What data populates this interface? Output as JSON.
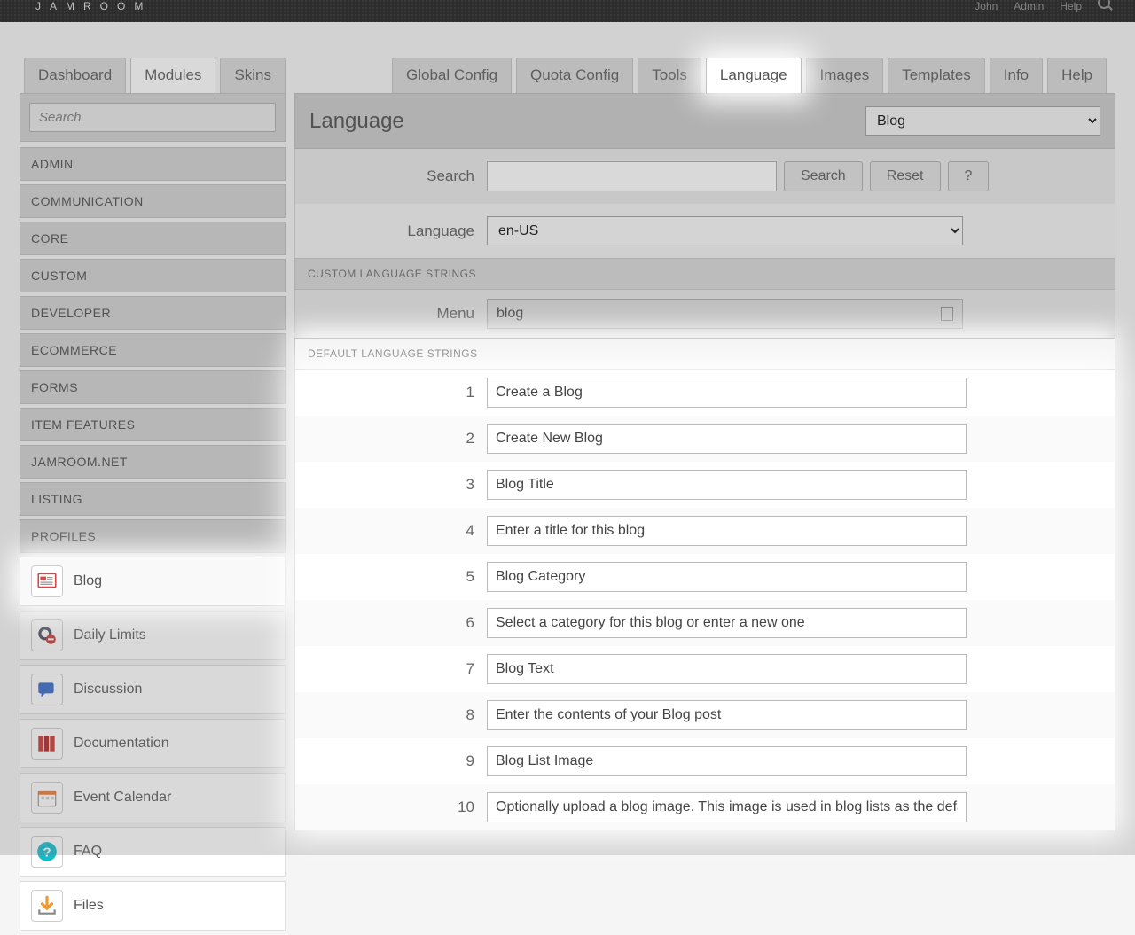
{
  "brand": "JAMROOM",
  "top_right": [
    "John",
    "Admin",
    "Help"
  ],
  "primary_tabs": {
    "left": [
      "Dashboard",
      "Modules",
      "Skins"
    ],
    "left_active": 1
  },
  "module_tabs": [
    "Global Config",
    "Quota Config",
    "Tools",
    "Language",
    "Images",
    "Templates",
    "Info",
    "Help"
  ],
  "module_tabs_active_index": 3,
  "sidebar": {
    "search_placeholder": "Search",
    "categories": [
      "ADMIN",
      "COMMUNICATION",
      "CORE",
      "CUSTOM",
      "DEVELOPER",
      "ECOMMERCE",
      "FORMS",
      "ITEM FEATURES",
      "JAMROOM.NET",
      "LISTING",
      "PROFILES"
    ],
    "items": [
      {
        "label": "Blog",
        "highlight": true
      },
      {
        "label": "Daily Limits"
      },
      {
        "label": "Discussion"
      },
      {
        "label": "Documentation"
      },
      {
        "label": "Event Calendar"
      },
      {
        "label": "FAQ"
      },
      {
        "label": "Files"
      }
    ]
  },
  "page": {
    "title": "Language",
    "module_select": "Blog",
    "search_label": "Search",
    "search_button": "Search",
    "reset_button": "Reset",
    "help_button": "?",
    "language_label": "Language",
    "language_value": "en-US",
    "custom_section": "CUSTOM LANGUAGE STRINGS",
    "menu_label": "Menu",
    "menu_value": "blog",
    "default_section": "DEFAULT LANGUAGE STRINGS",
    "strings": [
      {
        "n": "1",
        "v": "Create a Blog"
      },
      {
        "n": "2",
        "v": "Create New Blog"
      },
      {
        "n": "3",
        "v": "Blog Title"
      },
      {
        "n": "4",
        "v": "Enter a title for this blog"
      },
      {
        "n": "5",
        "v": "Blog Category"
      },
      {
        "n": "6",
        "v": "Select a category for this blog or enter a new one"
      },
      {
        "n": "7",
        "v": "Blog Text"
      },
      {
        "n": "8",
        "v": "Enter the contents of your Blog post"
      },
      {
        "n": "9",
        "v": "Blog List Image"
      },
      {
        "n": "10",
        "v": "Optionally upload a blog image. This image is used in blog lists as the default image."
      }
    ]
  }
}
